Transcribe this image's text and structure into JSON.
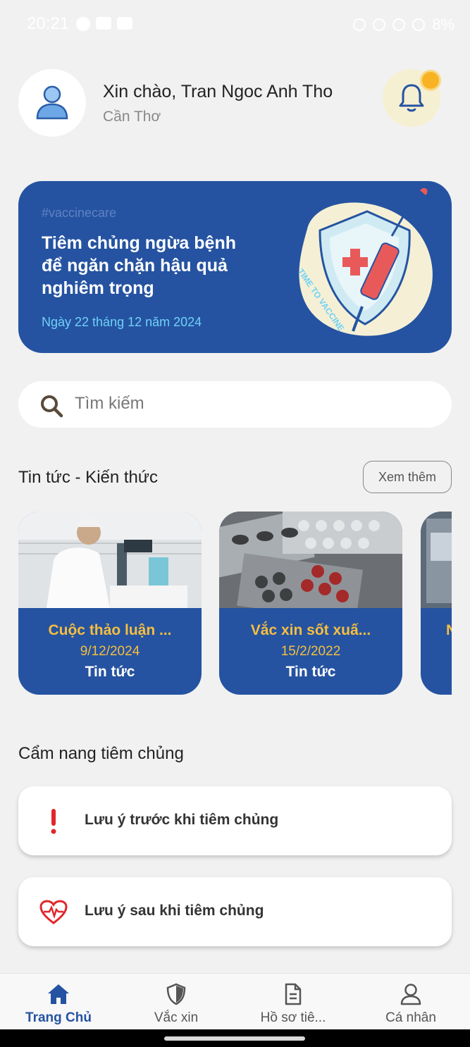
{
  "status_bar": {
    "time": "20:21",
    "battery": "8%"
  },
  "header": {
    "greeting": "Xin chào, Tran Ngoc Anh Tho",
    "location": "Cần Thơ"
  },
  "banner": {
    "tag": "#vaccinecare",
    "title": "Tiêm chủng ngừa bệnh để ngăn chặn hậu quả nghiêm trọng",
    "date": "Ngày 22 tháng 12 năm 2024",
    "art_caption": "TIME TO VACCINE"
  },
  "search": {
    "placeholder": "Tìm kiếm"
  },
  "news": {
    "title": "Tin tức - Kiến thức",
    "more_label": "Xem thêm",
    "items": [
      {
        "title": "Cuộc thảo luận ...",
        "date": "9/12/2024",
        "category": "Tin tức"
      },
      {
        "title": "Vắc xin sốt xuấ...",
        "date": "15/2/2022",
        "category": "Tin tức"
      },
      {
        "title": "N"
      }
    ]
  },
  "handbook": {
    "title": "Cẩm nang tiêm chủng",
    "items": [
      {
        "label": "Lưu ý trước khi tiêm chủng",
        "icon": "exclamation-icon"
      },
      {
        "label": "Lưu ý sau khi tiêm chủng",
        "icon": "heart-pulse-icon"
      }
    ]
  },
  "nav": {
    "items": [
      {
        "label": "Trang Chủ",
        "icon": "home-icon",
        "active": true
      },
      {
        "label": "Vắc xin",
        "icon": "shield-icon"
      },
      {
        "label": "Hồ sơ tiê...",
        "icon": "document-icon"
      },
      {
        "label": "Cá nhân",
        "icon": "person-icon"
      }
    ]
  },
  "colors": {
    "primary": "#2553a1",
    "accent": "#f6be3f",
    "background": "#f1f1f1"
  }
}
